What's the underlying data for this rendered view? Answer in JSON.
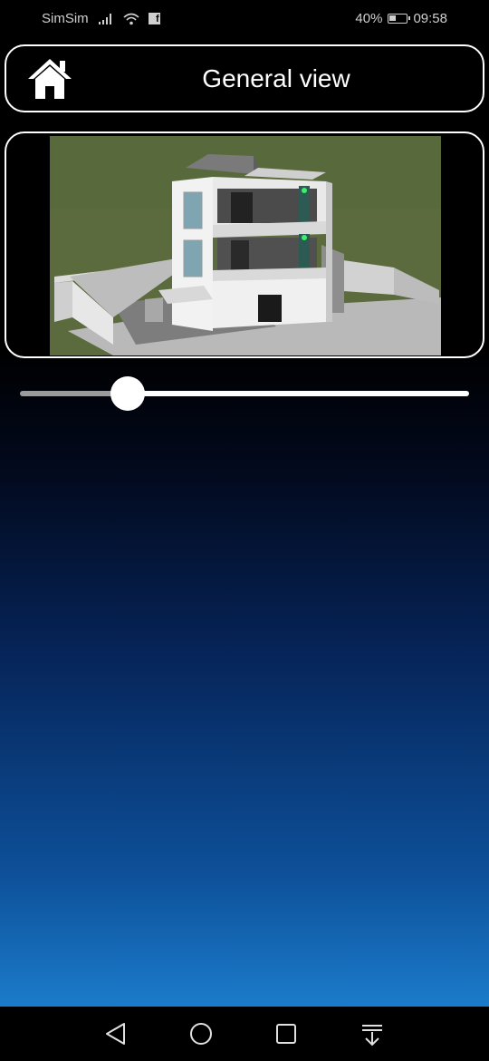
{
  "status_bar": {
    "carrier": "SimSim",
    "signal_icon": "signal-bars-icon",
    "wifi_icon": "wifi-icon",
    "notification_icon": "facebook-icon",
    "battery_percent": "40%",
    "battery_level": 0.4,
    "time": "09:58"
  },
  "header": {
    "home_icon": "home-icon",
    "title": "General view"
  },
  "viewer": {
    "image": "house-3d-render"
  },
  "slider": {
    "value": 0.24
  },
  "nav_bar": {
    "back_icon": "back-triangle-icon",
    "home_icon": "home-circle-icon",
    "recents_icon": "recents-square-icon",
    "notifications_icon": "pull-down-icon"
  },
  "colors": {
    "background_top": "#000000",
    "background_bottom": "#1e86d4",
    "frame_border": "#ffffff",
    "lawn": "#5b6b3d"
  }
}
